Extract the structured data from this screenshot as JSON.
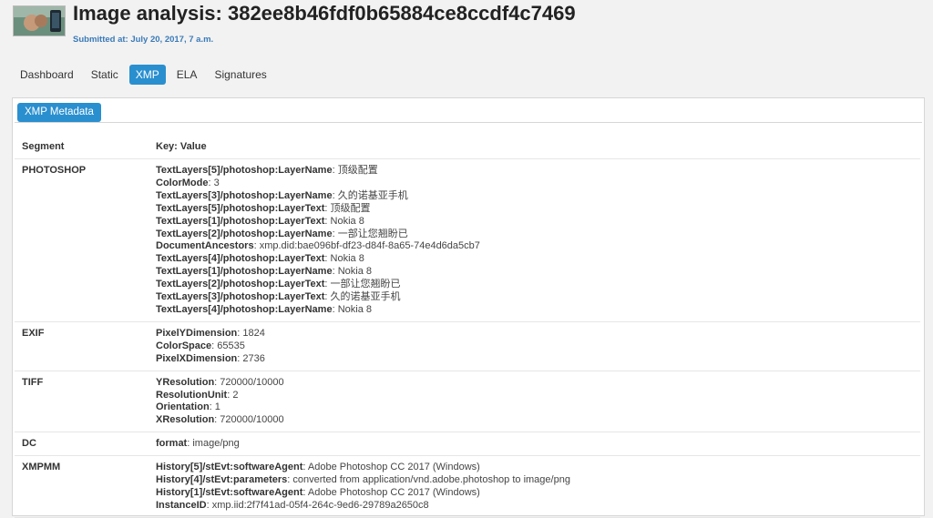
{
  "header": {
    "title": "Image analysis: 382ee8b46fdf0b65884ce8ccdf4c7469",
    "submitted": "Submitted at: July 20, 2017, 7 a.m."
  },
  "tabs": [
    {
      "label": "Dashboard"
    },
    {
      "label": "Static"
    },
    {
      "label": "XMP"
    },
    {
      "label": "ELA"
    },
    {
      "label": "Signatures"
    }
  ],
  "active_tab": "XMP",
  "panel": {
    "subtab_label": "XMP Metadata",
    "columns": {
      "segment": "Segment",
      "keyvalue": "Key: Value"
    },
    "rows": [
      {
        "segment": "PHOTOSHOP",
        "entries": [
          {
            "key": "TextLayers[5]/photoshop:LayerName",
            "value": "顶级配置"
          },
          {
            "key": "ColorMode",
            "value": "3"
          },
          {
            "key": "TextLayers[3]/photoshop:LayerName",
            "value": "久的诺基亚手机"
          },
          {
            "key": "TextLayers[5]/photoshop:LayerText",
            "value": "顶级配置"
          },
          {
            "key": "TextLayers[1]/photoshop:LayerText",
            "value": "Nokia 8"
          },
          {
            "key": "TextLayers[2]/photoshop:LayerName",
            "value": "一部让您翘盼已"
          },
          {
            "key": "DocumentAncestors",
            "value": "xmp.did:bae096bf-df23-d84f-8a65-74e4d6da5cb7"
          },
          {
            "key": "TextLayers[4]/photoshop:LayerText",
            "value": "Nokia 8"
          },
          {
            "key": "TextLayers[1]/photoshop:LayerName",
            "value": "Nokia 8"
          },
          {
            "key": "TextLayers[2]/photoshop:LayerText",
            "value": "一部让您翘盼已"
          },
          {
            "key": "TextLayers[3]/photoshop:LayerText",
            "value": "久的诺基亚手机"
          },
          {
            "key": "TextLayers[4]/photoshop:LayerName",
            "value": "Nokia 8"
          }
        ]
      },
      {
        "segment": "EXIF",
        "entries": [
          {
            "key": "PixelYDimension",
            "value": "1824"
          },
          {
            "key": "ColorSpace",
            "value": "65535"
          },
          {
            "key": "PixelXDimension",
            "value": "2736"
          }
        ]
      },
      {
        "segment": "TIFF",
        "entries": [
          {
            "key": "YResolution",
            "value": "720000/10000"
          },
          {
            "key": "ResolutionUnit",
            "value": "2"
          },
          {
            "key": "Orientation",
            "value": "1"
          },
          {
            "key": "XResolution",
            "value": "720000/10000"
          }
        ]
      },
      {
        "segment": "DC",
        "entries": [
          {
            "key": "format",
            "value": "image/png"
          }
        ]
      },
      {
        "segment": "XMPMM",
        "entries": [
          {
            "key": "History[5]/stEvt:softwareAgent",
            "value": "Adobe Photoshop CC 2017 (Windows)"
          },
          {
            "key": "History[4]/stEvt:parameters",
            "value": "converted from application/vnd.adobe.photoshop to image/png"
          },
          {
            "key": "History[1]/stEvt:softwareAgent",
            "value": "Adobe Photoshop CC 2017 (Windows)"
          },
          {
            "key": "InstanceID",
            "value": "xmp.iid:2f7f41ad-05f4-264c-9ed6-29789a2650c8"
          }
        ]
      }
    ]
  },
  "colors": {
    "accent": "#2a8fcf",
    "link": "#3a7ab8",
    "background": "#f2f2f2"
  }
}
